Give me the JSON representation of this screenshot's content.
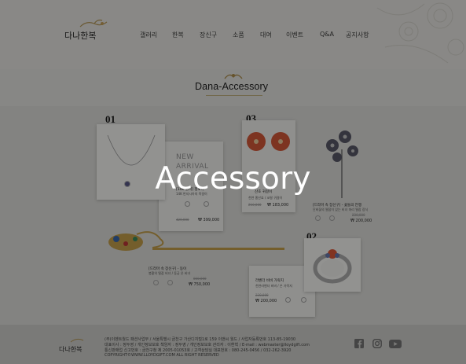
{
  "brand": {
    "logo_text": "다나한복"
  },
  "nav": {
    "items": [
      "갤러리",
      "한복",
      "장신구",
      "소품",
      "대여",
      "이벤트",
      "Q&A",
      "공지사항"
    ]
  },
  "section": {
    "title": "Dana-Accessory"
  },
  "overlay": {
    "title": "Accessory"
  },
  "products": {
    "p1": {
      "number": "01",
      "badge": "NEW ARRIVAL",
      "name": "[14K 원석] 정노리",
      "sub": "14K 반지시아의 목걸이",
      "price_old": "420,000",
      "price": "₩ 399,000"
    },
    "p2": {
      "number": "03",
      "name": "산호 귀걸이",
      "sub": "천연 홍산호 / 코랄 귀걸이",
      "price_old": "210,000",
      "price": "₩ 183,000"
    },
    "p3": {
      "name": "[드라마 속 장신구] - 꽃들의 전쟁",
      "sub": "단비꽃의 떨잠이 있는 비녀 마리 떨잠 장식",
      "price_old": "230,000",
      "price": "₩ 200,000"
    },
    "p4": {
      "name": "[드라마 속 장신구] - 동이",
      "sub": "봉황의 떨잠 비녀 / 동궁 은 비녀",
      "price_old": "800,000",
      "price": "₩ 750,000"
    },
    "p5": {
      "number": "02",
      "name": "라벤더 비비 가락지",
      "sub": "천연라벤더 비비 / 은 가락지",
      "price_old": "230,000",
      "price": "₩ 200,000"
    }
  },
  "footer": {
    "lines": [
      "(주)이벤트월드 패션사업부 / 서울특별시 금천구 가산디지털1로 159 이앤씨 월드 / 사업자등록번호 113-85-19030",
      "대표이사 : 정두영 / 개인정보보호 책임자 : 정두영 / 개인정보보호 관리자 : 이환혁 / E-mail : webmaster@lloydgift.com",
      "통신판매업 신고번호 : 금천구청 제 2005-01053호 / 고객상담실 대표번호 : 080-245-0456 / 032-262-3920",
      "COPYRIGHT©WWW.LLOYDGIFT.COM ALL RIGHT RESERVED"
    ],
    "social": [
      "facebook-icon",
      "instagram-icon",
      "youtube-icon"
    ]
  }
}
